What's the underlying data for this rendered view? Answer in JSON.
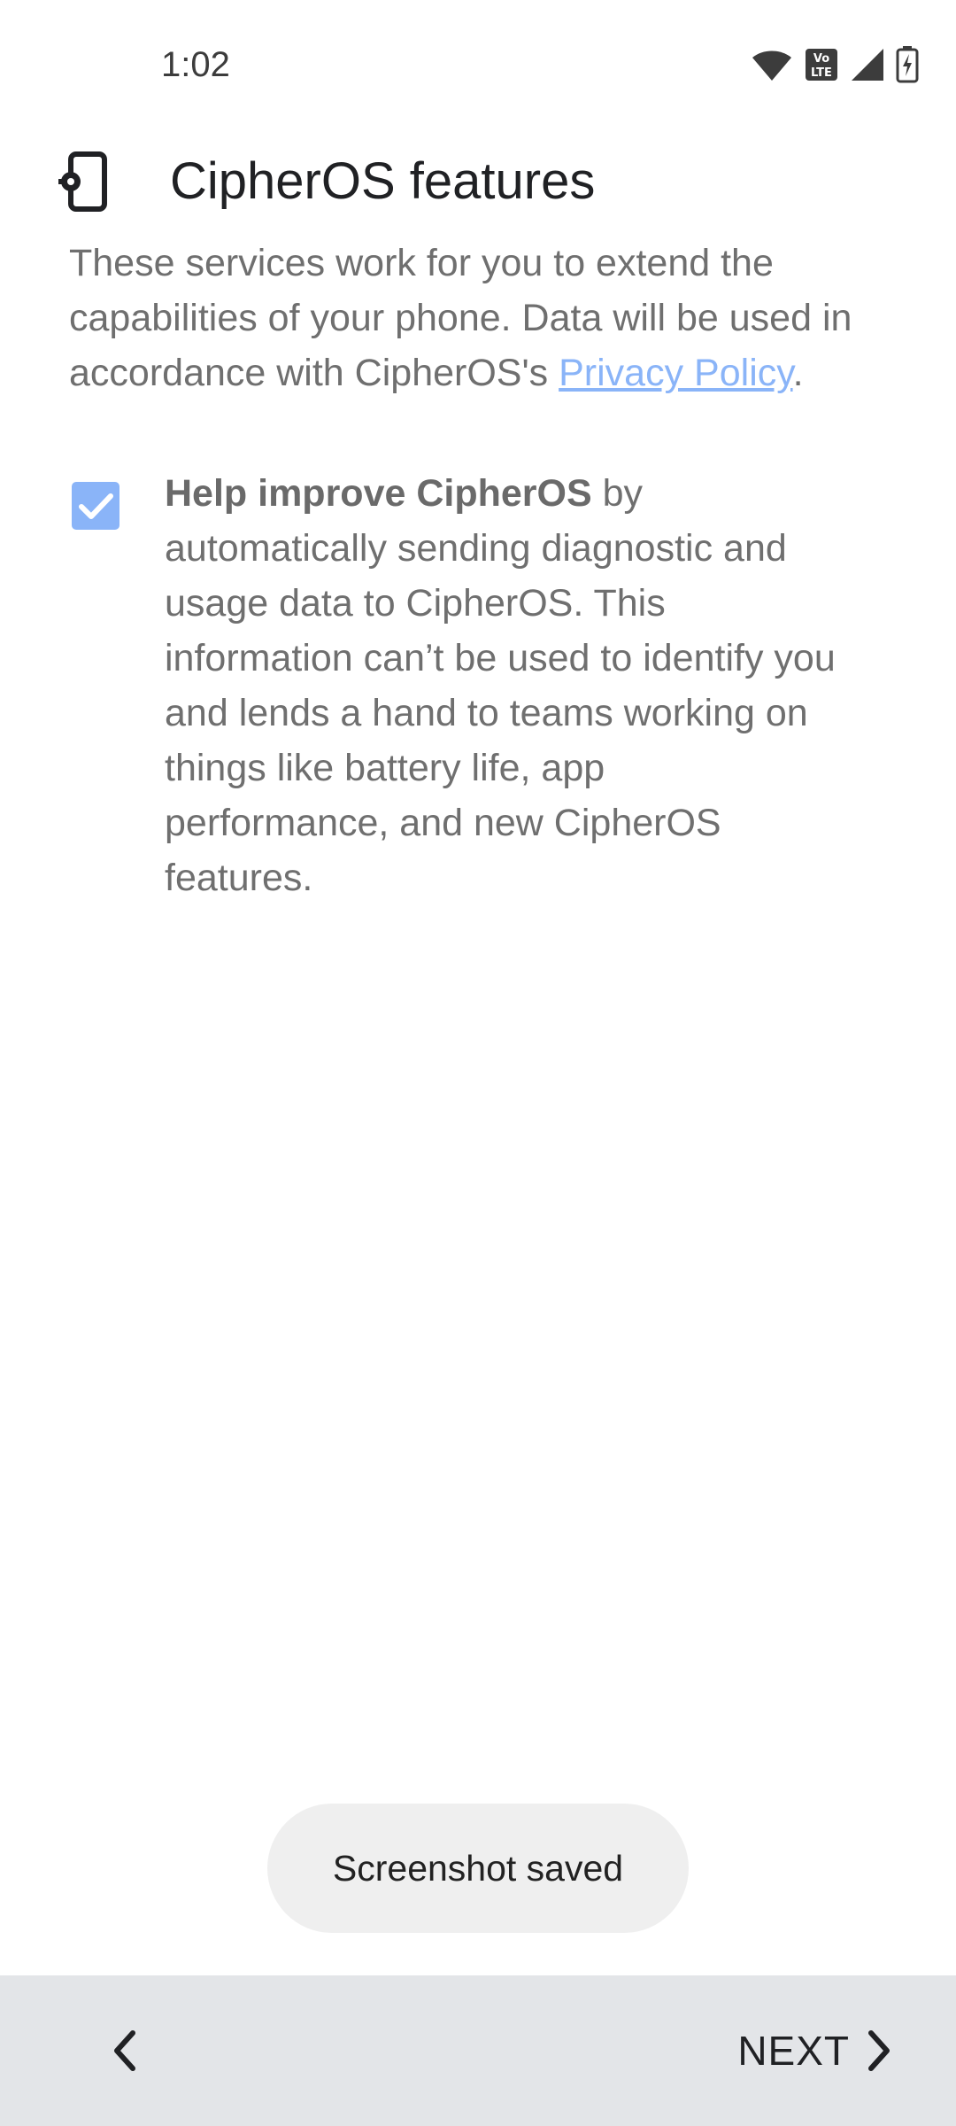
{
  "status_bar": {
    "time": "1:02",
    "icons": [
      "wifi-icon",
      "volte-icon",
      "signal-icon",
      "battery-charging-icon"
    ]
  },
  "header": {
    "icon": "phone-settings-icon",
    "title": "CipherOS features"
  },
  "intro": {
    "text_before_link": "These services work for you to extend the capabilities of your phone. Data will be used in accordance with CipherOS's ",
    "link_text": "Privacy Policy",
    "text_after_link": "."
  },
  "option": {
    "checked": true,
    "bold_text": "Help improve CipherOS",
    "rest_text": " by automatically sending diagnostic and usage data to CipherOS. This information can’t be used to identify you and lends a hand to teams working on things like battery life, app performance, and new CipherOS features."
  },
  "toast": {
    "text": "Screenshot saved"
  },
  "bottom_nav": {
    "back_icon": "chevron-left-icon",
    "next_label": "NEXT",
    "next_icon": "chevron-right-icon"
  },
  "colors": {
    "accent": "#8ab4f8",
    "bottom_bar": "#e3e5e8",
    "toast_bg": "#efefef"
  }
}
